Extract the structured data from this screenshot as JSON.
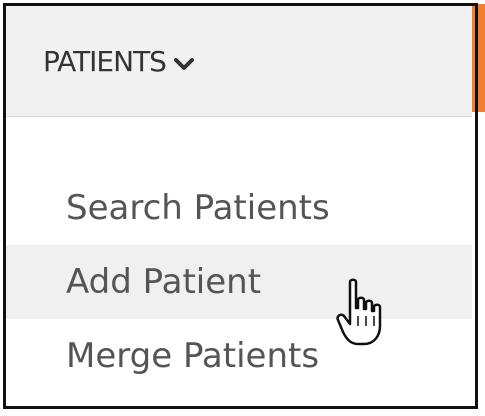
{
  "menu": {
    "title": "PATIENTS",
    "title_icon": "chevron-down-icon",
    "items": [
      {
        "label": "Search Patients",
        "state": "normal"
      },
      {
        "label": "Add Patient",
        "state": "hover"
      },
      {
        "label": "Merge Patients",
        "state": "normal"
      }
    ]
  },
  "colors": {
    "accent": "#f28030",
    "text_primary": "#333333",
    "text_secondary": "#555555",
    "hover_bg": "#f0f0f0"
  },
  "cursor": {
    "icon": "hand-pointer-icon"
  }
}
